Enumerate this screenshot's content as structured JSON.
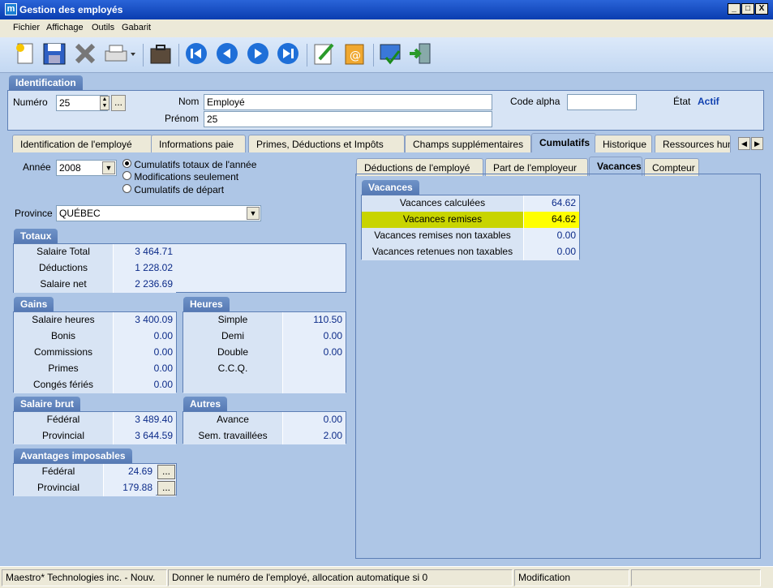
{
  "window": {
    "title": "Gestion des employés",
    "app_icon": "m",
    "minimize": "_",
    "restore": "□",
    "close": "X"
  },
  "menu": [
    "Fichier",
    "Affichage",
    "Outils",
    "Gabarit"
  ],
  "identification": {
    "tab": "Identification",
    "numero_label": "Numéro",
    "numero_value": "25",
    "nom_label": "Nom",
    "nom_value": "Employé",
    "prenom_label": "Prénom",
    "prenom_value": "25",
    "code_alpha_label": "Code alpha",
    "code_alpha_value": "",
    "etat_label": "État",
    "etat_value": "Actif"
  },
  "main_tabs": [
    "Identification de l'employé",
    "Informations paie",
    "Primes, Déductions et Impôts",
    "Champs supplémentaires",
    "Cumulatifs",
    "Historique",
    "Ressources hum"
  ],
  "annee": {
    "label": "Année",
    "value": "2008"
  },
  "radios": [
    {
      "label": "Cumulatifs totaux de l'année",
      "selected": true
    },
    {
      "label": "Modifications seulement",
      "selected": false
    },
    {
      "label": "Cumulatifs de départ",
      "selected": false
    }
  ],
  "province": {
    "label": "Province",
    "value": "QUÉBEC"
  },
  "totaux": {
    "title": "Totaux",
    "rows": [
      {
        "label": "Salaire Total",
        "value": "3 464.71"
      },
      {
        "label": "Déductions",
        "value": "1 228.02"
      },
      {
        "label": "Salaire net",
        "value": "2 236.69"
      }
    ]
  },
  "gains": {
    "title": "Gains",
    "rows": [
      {
        "label": "Salaire heures",
        "value": "3 400.09"
      },
      {
        "label": "Bonis",
        "value": "0.00"
      },
      {
        "label": "Commissions",
        "value": "0.00"
      },
      {
        "label": "Primes",
        "value": "0.00"
      },
      {
        "label": "Congés fériés",
        "value": "0.00"
      }
    ]
  },
  "heures": {
    "title": "Heures",
    "rows": [
      {
        "label": "Simple",
        "value": "110.50"
      },
      {
        "label": "Demi",
        "value": "0.00"
      },
      {
        "label": "Double",
        "value": "0.00"
      },
      {
        "label": "C.C.Q.",
        "value": ""
      },
      {
        "label": "",
        "value": ""
      }
    ]
  },
  "salaire_brut": {
    "title": "Salaire brut",
    "rows": [
      {
        "label": "Fédéral",
        "value": "3 489.40"
      },
      {
        "label": "Provincial",
        "value": "3 644.59"
      }
    ]
  },
  "autres": {
    "title": "Autres",
    "rows": [
      {
        "label": "Avance",
        "value": "0.00"
      },
      {
        "label": "Sem. travaillées",
        "value": "2.00"
      }
    ]
  },
  "avantages": {
    "title": "Avantages imposables",
    "rows": [
      {
        "label": "Fédéral",
        "value": "24.69",
        "btn": "..."
      },
      {
        "label": "Provincial",
        "value": "179.88",
        "btn": "..."
      }
    ]
  },
  "sub_tabs": [
    "Déductions de l'employé",
    "Part de l'employeur",
    "Vacances",
    "Compteur"
  ],
  "vacances": {
    "title": "Vacances",
    "rows": [
      {
        "label": "Vacances calculées",
        "value": "64.62"
      },
      {
        "label": "Vacances remises",
        "value": "64.62"
      },
      {
        "label": "Vacances remises non taxables",
        "value": "0.00"
      },
      {
        "label": "Vacances retenues non taxables",
        "value": "0.00"
      }
    ],
    "highlight_color": "#c8d400",
    "highlight_value_color": "#ffff00"
  },
  "status": {
    "company": "Maestro* Technologies inc. - Nouv.",
    "hint": "Donner le numéro de l'employé, allocation automatique si  0",
    "mode": "Modification"
  },
  "colors": {
    "title_bar": "#0a3db0",
    "background": "#aec6e6",
    "section_tab": "#5578b3"
  }
}
